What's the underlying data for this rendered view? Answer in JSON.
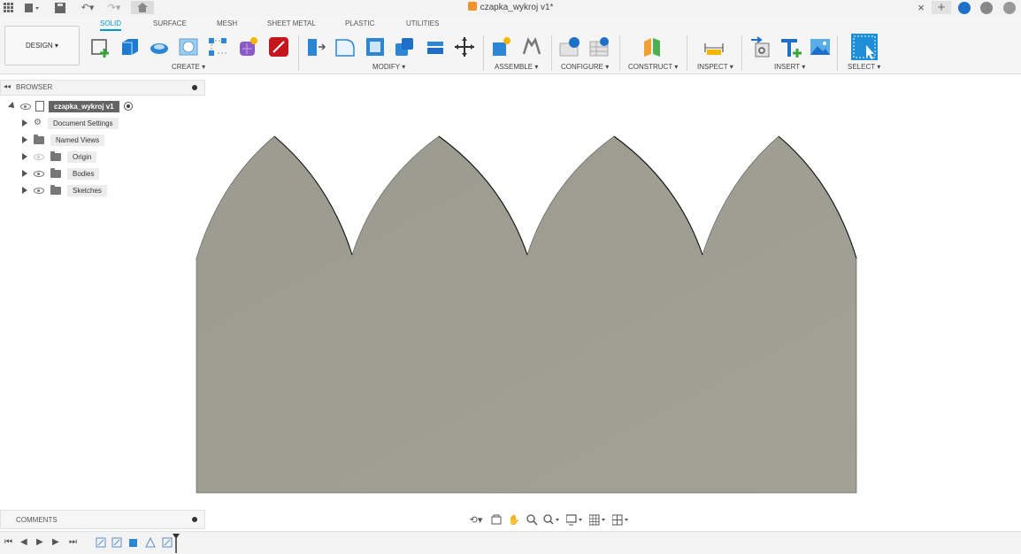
{
  "window": {
    "title": "czapka_wykroj v1*"
  },
  "toolbar": {
    "workspace_label": "DESIGN",
    "tabs": [
      "SOLID",
      "SURFACE",
      "MESH",
      "SHEET METAL",
      "PLASTIC",
      "UTILITIES"
    ],
    "groups": [
      "CREATE",
      "MODIFY",
      "ASSEMBLE",
      "CONFIGURE",
      "CONSTRUCT",
      "INSPECT",
      "INSERT",
      "SELECT"
    ]
  },
  "browser": {
    "title": "BROWSER",
    "root": "czapka_wykroj v1",
    "items": [
      {
        "label": "Document Settings",
        "icon": "gear-icon",
        "visible": null
      },
      {
        "label": "Named Views",
        "icon": "folder-icon",
        "visible": null
      },
      {
        "label": "Origin",
        "icon": "folder-icon",
        "visible": false
      },
      {
        "label": "Bodies",
        "icon": "folder-icon",
        "visible": true
      },
      {
        "label": "Sketches",
        "icon": "folder-icon",
        "visible": true
      }
    ]
  },
  "comments": {
    "title": "COMMENTS"
  },
  "colors": {
    "accent": "#0696d7",
    "body_fill": "#9a9a8e",
    "canvas_bg": "#ffffff"
  }
}
